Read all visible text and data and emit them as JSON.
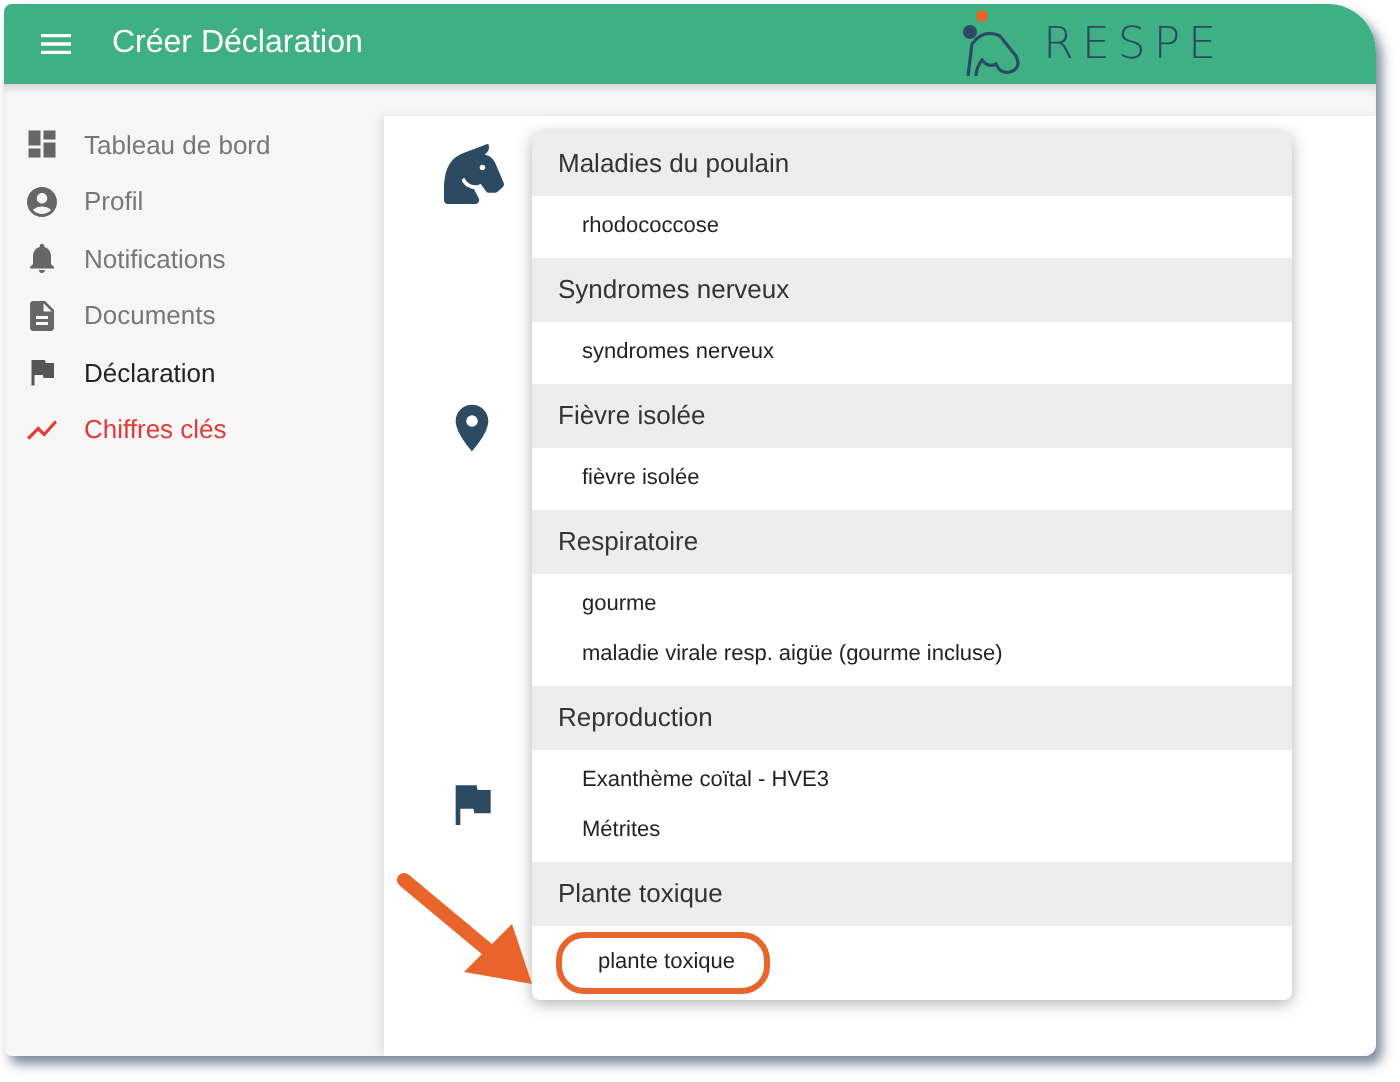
{
  "app_bar": {
    "title": "Créer Déclaration",
    "logo_text": "RESPE"
  },
  "sidebar": {
    "items": [
      {
        "label": "Tableau de bord",
        "selected": false,
        "kind": "page"
      },
      {
        "label": "Profil",
        "selected": false,
        "kind": "page"
      },
      {
        "label": "Notifications",
        "selected": false,
        "kind": "page"
      },
      {
        "label": "Documents",
        "selected": false,
        "kind": "page"
      },
      {
        "label": "Déclaration",
        "selected": true,
        "kind": "page"
      },
      {
        "label": "Chiffres clés",
        "selected": false,
        "kind": "accent"
      }
    ]
  },
  "dropdown": {
    "groups": [
      {
        "label": "Maladies du poulain",
        "options": [
          {
            "label": "rhodococcose",
            "highlighted": false
          }
        ]
      },
      {
        "label": "Syndromes nerveux",
        "options": [
          {
            "label": "syndromes nerveux",
            "highlighted": false
          }
        ]
      },
      {
        "label": "Fièvre isolée",
        "options": [
          {
            "label": "fièvre isolée",
            "highlighted": false
          }
        ]
      },
      {
        "label": "Respiratoire",
        "options": [
          {
            "label": "gourme",
            "highlighted": false
          },
          {
            "label": "maladie virale resp. aigüe (gourme incluse)",
            "highlighted": false
          }
        ]
      },
      {
        "label": "Reproduction",
        "options": [
          {
            "label": "Exanthème coïtal - HVE3",
            "highlighted": false
          },
          {
            "label": "Métrites",
            "highlighted": false
          }
        ]
      },
      {
        "label": "Plante toxique",
        "options": [
          {
            "label": "plante toxique",
            "highlighted": true
          }
        ]
      }
    ]
  }
}
